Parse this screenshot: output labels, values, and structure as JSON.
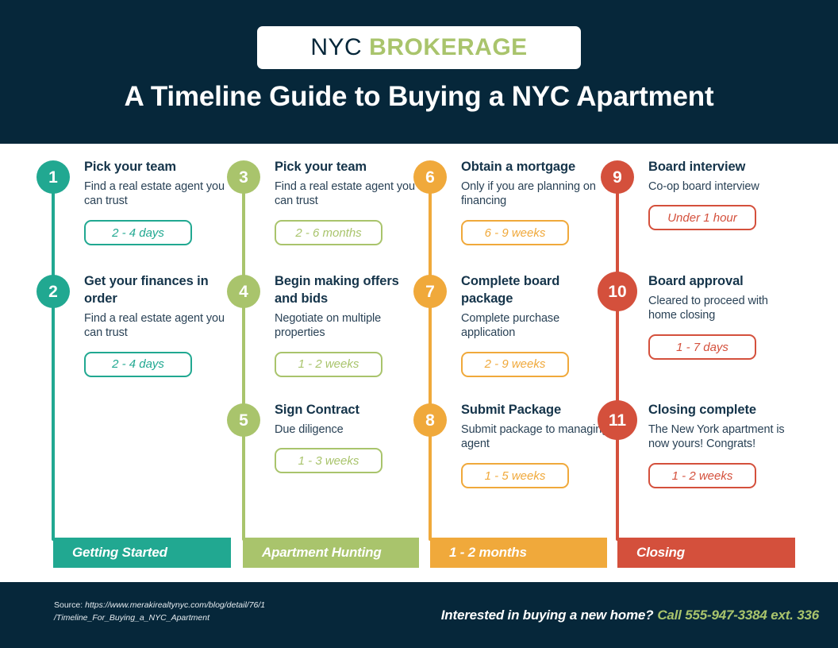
{
  "header": {
    "logo_primary": "NYC",
    "logo_secondary": "BROKERAGE",
    "title": "A Timeline Guide to Buying a NYC Apartment"
  },
  "colors": {
    "dark": "#06273a",
    "teal": "#21a891",
    "green": "#a9c46c",
    "amber": "#f0a93b",
    "red": "#d4503c"
  },
  "columns": [
    {
      "phase_label": "Getting Started",
      "color": "#21a891",
      "steps": [
        {
          "number": "1",
          "title": "Pick your team",
          "desc": "Find a real estate agent you can trust",
          "duration": "2 - 4 days"
        },
        {
          "number": "2",
          "title": "Get your finances in order",
          "desc": "Find a real estate agent you can trust",
          "duration": "2 - 4 days"
        }
      ]
    },
    {
      "phase_label": "Apartment Hunting",
      "color": "#a9c46c",
      "steps": [
        {
          "number": "3",
          "title": "Pick your team",
          "desc": "Find a real estate agent you can trust",
          "duration": "2 - 6 months"
        },
        {
          "number": "4",
          "title": "Begin making offers and bids",
          "desc": "Negotiate on multiple properties",
          "duration": "1 - 2 weeks"
        },
        {
          "number": "5",
          "title": "Sign Contract",
          "desc": "Due diligence",
          "duration": "1 - 3 weeks"
        }
      ]
    },
    {
      "phase_label": "1 - 2 months",
      "color": "#f0a93b",
      "steps": [
        {
          "number": "6",
          "title": "Obtain a mortgage",
          "desc": "Only if you are planning on financing",
          "duration": "6 - 9 weeks"
        },
        {
          "number": "7",
          "title": "Complete board package",
          "desc": "Complete purchase application",
          "duration": "2 - 9 weeks"
        },
        {
          "number": "8",
          "title": "Submit Package",
          "desc": "Submit package to managing agent",
          "duration": "1 - 5 weeks"
        }
      ]
    },
    {
      "phase_label": "Closing",
      "color": "#d4503c",
      "steps": [
        {
          "number": "9",
          "title": "Board interview",
          "desc": "Co-op board interview",
          "duration": "Under 1 hour"
        },
        {
          "number": "10",
          "title": "Board approval",
          "desc": "Cleared to proceed with home closing",
          "duration": "1 - 7 days"
        },
        {
          "number": "11",
          "title": "Closing complete",
          "desc": "The New York apartment is now yours! Congrats!",
          "duration": "1 - 2 weeks"
        }
      ]
    }
  ],
  "footer": {
    "source_label": "Source: ",
    "source_url": "https://www.merakirealtynyc.com/blog/detail/76/1 /Timeline_For_Buying_a_NYC_Apartment",
    "cta_question": "Interested in buying a new home?",
    "cta_phone": "Call 555-947-3384 ext. 336"
  }
}
